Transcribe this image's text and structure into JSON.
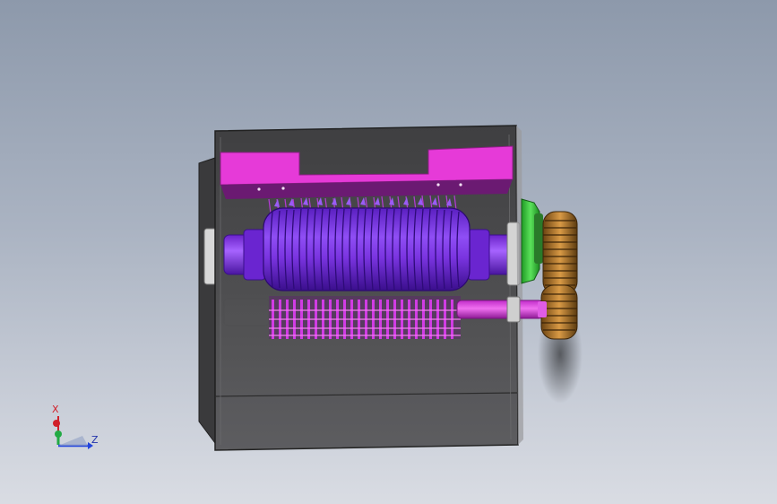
{
  "viewport": {
    "background_top": "#8d99ab",
    "background_bottom": "#d9dce3"
  },
  "model": {
    "housing_color": "#4b4b4d",
    "bar_color": "#e63ad8",
    "rotor_color": "#7a34e0",
    "shaft_color": "#9b3ff0",
    "gear_color": "#b5782a",
    "bearing_color": "#3ecf3e",
    "blade_color": "#d13ce4"
  },
  "triad": {
    "x_label": "X",
    "z_label": "Z",
    "x_color": "#d0202a",
    "y_color": "#22aa44",
    "z_color": "#2244dd"
  }
}
